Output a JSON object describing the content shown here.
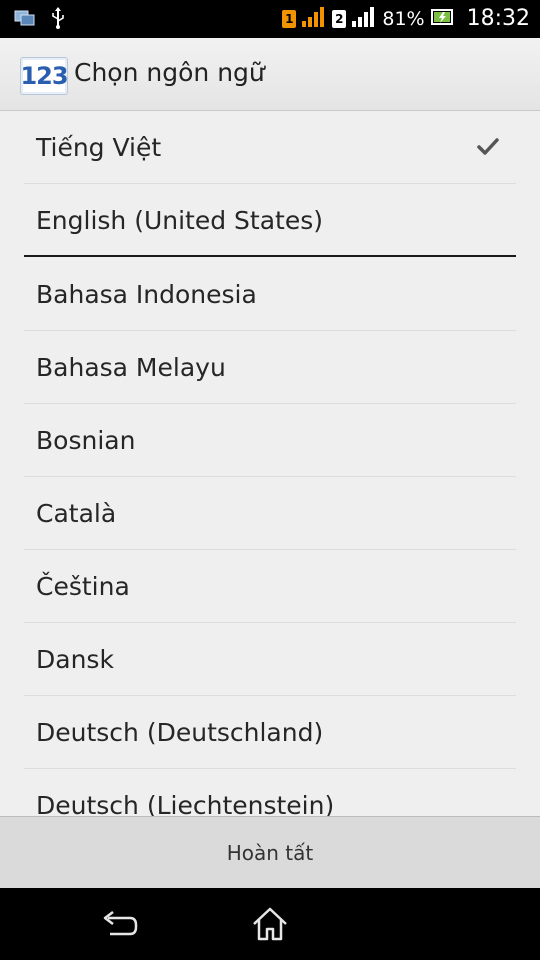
{
  "status_bar": {
    "sim1": "1",
    "sim2": "2",
    "battery": "81%",
    "time": "18:32"
  },
  "title_bar": {
    "icon_text": "123",
    "title": "Chọn ngôn ngữ"
  },
  "languages": {
    "selected": [
      {
        "label": "Tiếng Việt",
        "checked": true
      },
      {
        "label": "English (United States)",
        "checked": false
      }
    ],
    "others": [
      {
        "label": "Bahasa Indonesia"
      },
      {
        "label": "Bahasa Melayu"
      },
      {
        "label": "Bosnian"
      },
      {
        "label": "Català"
      },
      {
        "label": "Čeština"
      },
      {
        "label": "Dansk"
      },
      {
        "label": "Deutsch (Deutschland)"
      },
      {
        "label": "Deutsch (Liechtenstein)"
      }
    ]
  },
  "done_button": {
    "label": "Hoàn tất"
  },
  "colors": {
    "accent_sim1": "#f29400",
    "list_background": "#efefef"
  }
}
